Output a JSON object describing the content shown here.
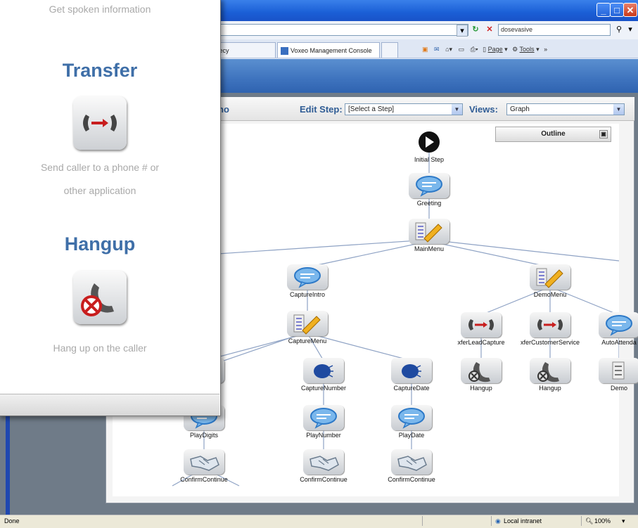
{
  "browser": {
    "search_value": "dosevasive",
    "tabs": [
      {
        "label": "vecy"
      },
      {
        "label": "Voxeo Management Console"
      }
    ],
    "commands": {
      "page": "Page",
      "tools": "Tools"
    },
    "more_glyph": "»"
  },
  "toolbar": {
    "partial_title": "no",
    "edit_step_label": "Edit Step:",
    "edit_step_value": "[Select a Step]",
    "views_label": "Views:",
    "views_value": "Graph",
    "outline_label": "Outline"
  },
  "graph": {
    "nodes": [
      {
        "id": "initial",
        "label": "Initial Step",
        "icon": "play-icon"
      },
      {
        "id": "greeting",
        "label": "Greeting",
        "icon": "speech-bubble-icon"
      },
      {
        "id": "mainmenu",
        "label": "MainMenu",
        "icon": "menu-pencil-icon"
      },
      {
        "id": "captureintro",
        "label": "CaptureIntro",
        "icon": "speech-bubble-icon"
      },
      {
        "id": "demomenu",
        "label": "DemoMenu",
        "icon": "menu-pencil-icon"
      },
      {
        "id": "capturemenu",
        "label": "CaptureMenu",
        "icon": "menu-pencil-icon"
      },
      {
        "id": "xferlead",
        "label": "xferLeadCapture",
        "icon": "transfer-icon"
      },
      {
        "id": "xfercust",
        "label": "xferCustomerService",
        "icon": "transfer-icon"
      },
      {
        "id": "autoatt",
        "label": "AutoAttenda",
        "icon": "speech-bubble-icon"
      },
      {
        "id": "capturedigits",
        "label": "ts",
        "icon": "head-icon"
      },
      {
        "id": "capturenumber",
        "label": "CaptureNumber",
        "icon": "head-icon"
      },
      {
        "id": "capturedate",
        "label": "CaptureDate",
        "icon": "head-icon"
      },
      {
        "id": "hangup1",
        "label": "Hangup",
        "icon": "hangup-icon"
      },
      {
        "id": "hangup2",
        "label": "Hangup",
        "icon": "hangup-icon"
      },
      {
        "id": "demo",
        "label": "Demo",
        "icon": "menu-icon"
      },
      {
        "id": "playdigits",
        "label": "PlayDigits",
        "icon": "speech-bubble-icon"
      },
      {
        "id": "playnumber",
        "label": "PlayNumber",
        "icon": "speech-bubble-icon"
      },
      {
        "id": "playdate",
        "label": "PlayDate",
        "icon": "speech-bubble-icon"
      },
      {
        "id": "confirm1",
        "label": "ConfirmContinue",
        "icon": "handshake-icon"
      },
      {
        "id": "confirm2",
        "label": "ConfirmContinue",
        "icon": "handshake-icon"
      },
      {
        "id": "confirm3",
        "label": "ConfirmContinue",
        "icon": "handshake-icon"
      }
    ],
    "edges": [
      [
        "initial",
        "greeting"
      ],
      [
        "greeting",
        "mainmenu"
      ],
      [
        "mainmenu",
        "captureintro"
      ],
      [
        "mainmenu",
        "demomenu"
      ],
      [
        "captureintro",
        "capturemenu"
      ],
      [
        "capturemenu",
        "capturedigits"
      ],
      [
        "capturemenu",
        "capturenumber"
      ],
      [
        "capturemenu",
        "capturedate"
      ],
      [
        "demomenu",
        "xferlead"
      ],
      [
        "demomenu",
        "xfercust"
      ],
      [
        "demomenu",
        "autoatt"
      ],
      [
        "xferlead",
        "hangup1"
      ],
      [
        "xfercust",
        "hangup2"
      ],
      [
        "autoatt",
        "demo"
      ],
      [
        "capturedigits",
        "playdigits"
      ],
      [
        "capturenumber",
        "playnumber"
      ],
      [
        "capturedate",
        "playdate"
      ],
      [
        "playdigits",
        "confirm1"
      ],
      [
        "playnumber",
        "confirm2"
      ],
      [
        "playdate",
        "confirm3"
      ]
    ]
  },
  "palette": {
    "items": [
      {
        "title": "",
        "desc": [
          "Get spoken information"
        ],
        "icon": ""
      },
      {
        "title": "Transfer",
        "desc": [
          "Send caller to a phone # or",
          "other application"
        ],
        "icon": "transfer-icon"
      },
      {
        "title": "Hangup",
        "desc": [
          "Hang up on the caller"
        ],
        "icon": "hangup-icon"
      }
    ]
  },
  "status": {
    "text": "Done",
    "zone": "Local intranet",
    "zoom": "100%"
  }
}
